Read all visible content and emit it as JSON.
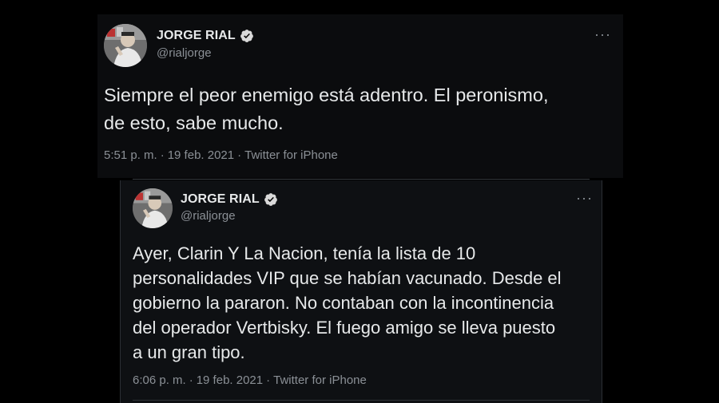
{
  "tweets": [
    {
      "author": {
        "name": "JORGE RIAL",
        "handle": "@rialjorge",
        "verified": true,
        "avatar_icon": "profile-photo"
      },
      "more_icon": "ellipsis-icon",
      "text": "Siempre el peor enemigo está adentro. El peronismo,\nde esto, sabe mucho.",
      "time": "5:51 p. m.",
      "date": "19 feb. 2021",
      "source": "Twitter for iPhone",
      "separator": "·"
    },
    {
      "author": {
        "name": "JORGE RIAL",
        "handle": "@rialjorge",
        "verified": true,
        "avatar_icon": "profile-photo"
      },
      "more_icon": "ellipsis-icon",
      "text": "Ayer, Clarin Y La Nacion, tenía la lista de 10\npersonalidades VIP que se habían vacunado. Desde el\ngobierno la pararon. No contaban con la incontinencia\ndel operador Vertbisky. El fuego amigo se lleva puesto\na un gran tipo.",
      "time": "6:06 p. m.",
      "date": "19 feb. 2021",
      "source": "Twitter for iPhone",
      "separator": "·"
    }
  ],
  "colors": {
    "background": "#000000",
    "text": "#e7e9ea",
    "muted": "#8b9096",
    "verified": "#d9d9d9"
  }
}
